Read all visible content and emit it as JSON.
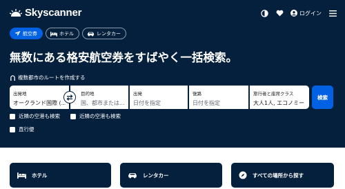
{
  "brand": {
    "name": "Skyscanner"
  },
  "header": {
    "login_label": "ログイン"
  },
  "tabs": [
    {
      "label": "航空券",
      "icon": "plane-icon",
      "active": true
    },
    {
      "label": "ホテル",
      "icon": "bed-icon",
      "active": false
    },
    {
      "label": "レンタカー",
      "icon": "car-icon",
      "active": false
    }
  ],
  "headline": "無数にある格安航空券をすばやく一括検索。",
  "multi_city_label": "複数都市のルートを作成する",
  "search": {
    "from_label": "出発地",
    "from_value": "オークランド国際 (...",
    "to_label": "目的地",
    "to_placeholder": "国、都市または...",
    "depart_label": "出発",
    "depart_placeholder": "日付を指定",
    "return_label": "復路",
    "return_placeholder": "日付を指定",
    "travellers_label": "旅行者と座席クラス",
    "travellers_value": "大人1人, エコノミー",
    "button_label": "検索"
  },
  "options": {
    "nearby_from": "近隣の空港も検索",
    "nearby_to": "近隣の空港も検索",
    "direct": "直行便"
  },
  "cards": [
    {
      "label": "ホテル",
      "icon": "bed-icon"
    },
    {
      "label": "レンタカー",
      "icon": "car-icon"
    },
    {
      "label": "すべての場所から探す",
      "icon": "explore-icon"
    }
  ],
  "colors": {
    "navy": "#05203c",
    "accent": "#0062e3"
  }
}
